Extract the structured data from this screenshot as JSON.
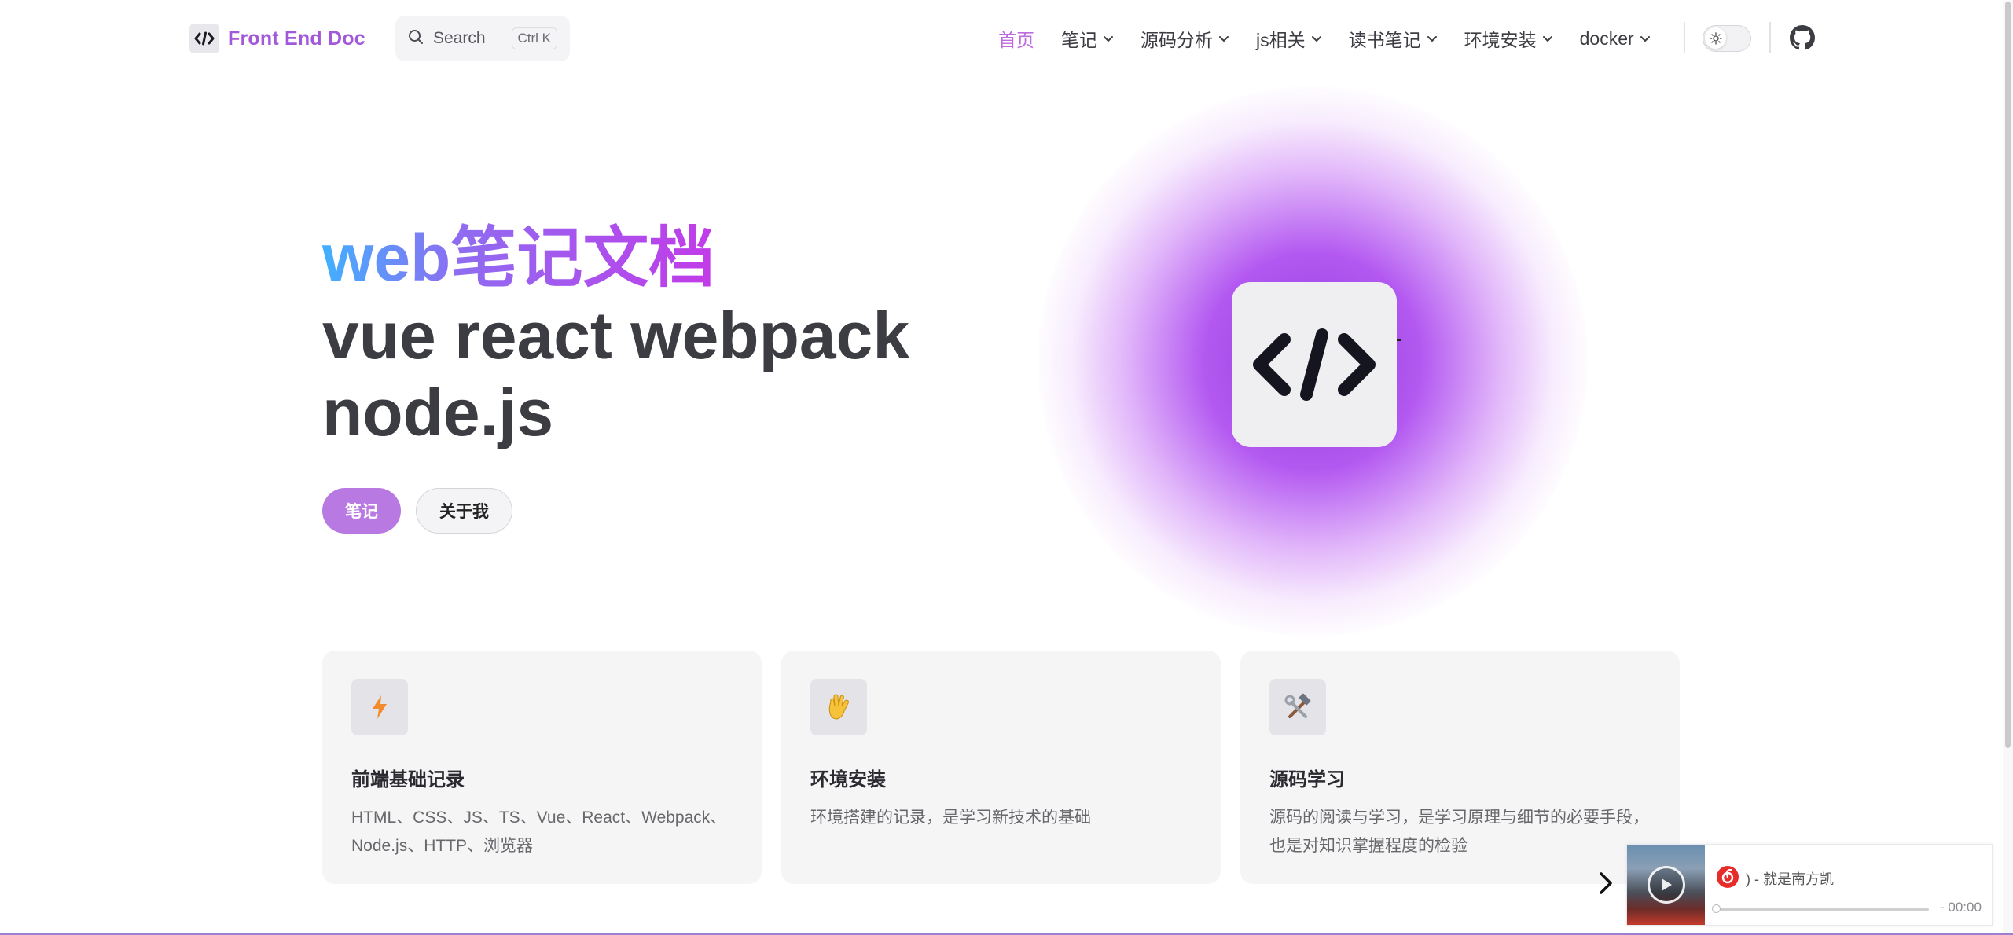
{
  "nav": {
    "brand": "Front End Doc",
    "search": {
      "label": "Search",
      "shortcut": "Ctrl K"
    },
    "menu": [
      {
        "label": "首页",
        "active": true,
        "dropdown": false
      },
      {
        "label": "笔记",
        "active": false,
        "dropdown": true
      },
      {
        "label": "源码分析",
        "active": false,
        "dropdown": true
      },
      {
        "label": "js相关",
        "active": false,
        "dropdown": true
      },
      {
        "label": "读书笔记",
        "active": false,
        "dropdown": true
      },
      {
        "label": "环境安装",
        "active": false,
        "dropdown": true
      },
      {
        "label": "docker",
        "active": false,
        "dropdown": true
      }
    ],
    "theme_icon": "sun-icon",
    "social_icon": "github-icon"
  },
  "hero": {
    "name": "web笔记文档",
    "text_line1": "vue react webpack",
    "text_line2": "node.js",
    "actions": [
      {
        "label": "笔记",
        "theme": "brand"
      },
      {
        "label": "关于我",
        "theme": "alt"
      }
    ]
  },
  "features": [
    {
      "icon": "lightning-icon",
      "title": "前端基础记录",
      "details": "HTML、CSS、JS、TS、Vue、React、Webpack、Node.js、HTTP、浏览器"
    },
    {
      "icon": "vulcan-salute-icon",
      "title": "环境安装",
      "details": "环境搭建的记录，是学习新技术的基础"
    },
    {
      "icon": "hammer-wrench-icon",
      "title": "源码学习",
      "details": "源码的阅读与学习，是学习原理与细节的必要手段，也是对知识掌握程度的检验"
    }
  ],
  "player": {
    "song": ") - 就是南方凯",
    "time": "- 00:00",
    "progress": 0
  },
  "colors": {
    "brand": "#bd6ce0",
    "button_brand": "#b979e2",
    "text": "#3c3c43",
    "gradient_start": "#41b0ff",
    "gradient_end": "#c23be9"
  }
}
